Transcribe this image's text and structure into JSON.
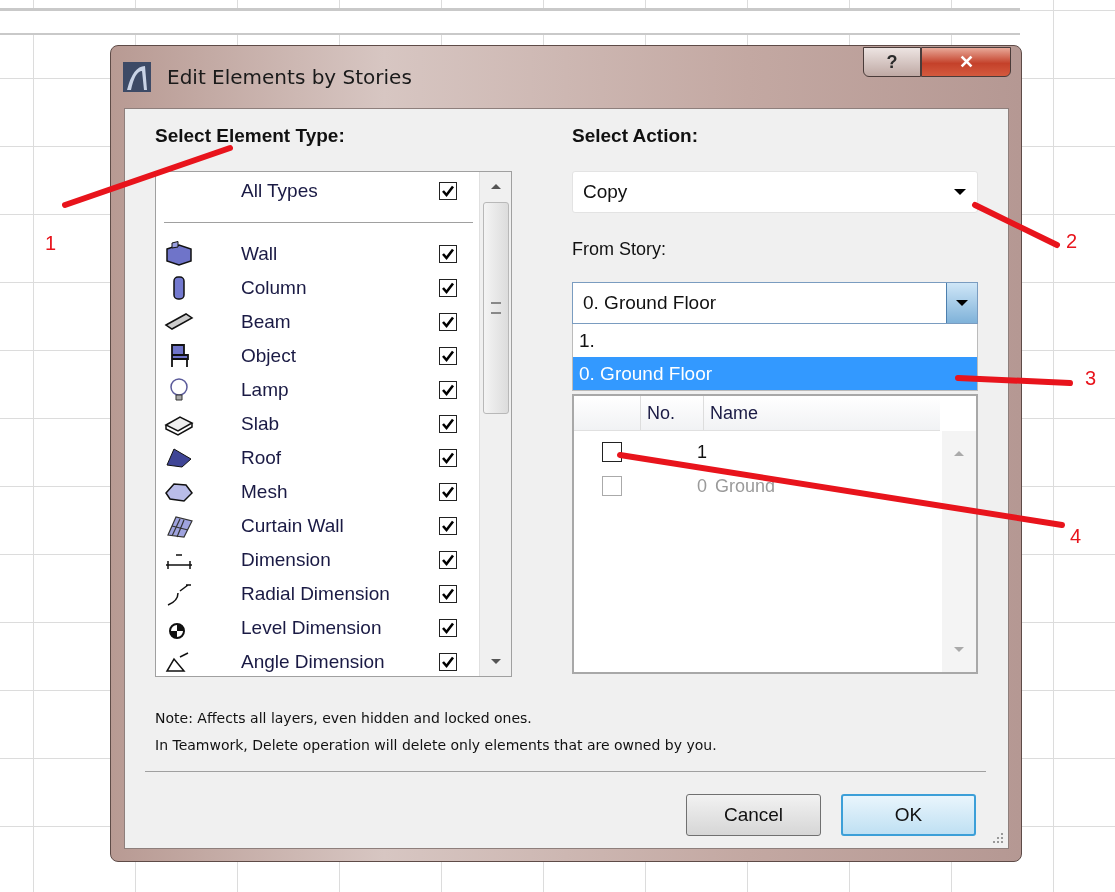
{
  "window": {
    "title": "Edit Elements by Stories"
  },
  "title_buttons": [
    {
      "kind": "help",
      "label": "?"
    },
    {
      "kind": "close",
      "label": "✕"
    }
  ],
  "element_types": {
    "heading": "Select Element Type:",
    "all": {
      "label": "All Types",
      "checked": true
    },
    "items": [
      {
        "label": "Wall",
        "checked": true
      },
      {
        "label": "Column",
        "checked": true
      },
      {
        "label": "Beam",
        "checked": true
      },
      {
        "label": "Object",
        "checked": true
      },
      {
        "label": "Lamp",
        "checked": true
      },
      {
        "label": "Slab",
        "checked": true
      },
      {
        "label": "Roof",
        "checked": true
      },
      {
        "label": "Mesh",
        "checked": true
      },
      {
        "label": "Curtain Wall",
        "checked": true
      },
      {
        "label": "Dimension",
        "checked": true
      },
      {
        "label": "Radial Dimension",
        "checked": true
      },
      {
        "label": "Level Dimension",
        "checked": true
      },
      {
        "label": "Angle Dimension",
        "checked": true
      }
    ]
  },
  "action": {
    "heading": "Select Action:",
    "value": "Copy"
  },
  "from_story": {
    "label": "From Story:",
    "value": "0. Ground Floor",
    "options": [
      {
        "label": "1.",
        "selected": false
      },
      {
        "label": "0. Ground Floor",
        "selected": true
      }
    ]
  },
  "story_table": {
    "columns": [
      "No.",
      "Name"
    ],
    "rows": [
      {
        "number": "1",
        "checked": false,
        "disabled": false
      },
      {
        "number": "0",
        "name": "Ground",
        "checked": false,
        "disabled": true
      }
    ]
  },
  "notes": [
    "Note: Affects all layers, even hidden and locked ones.",
    "In Teamwork, Delete operation will delete only elements that are owned by you."
  ],
  "buttons": [
    {
      "label": "Cancel",
      "default": false
    },
    {
      "label": "OK",
      "default": true
    }
  ],
  "annotations": [
    {
      "label": "1"
    },
    {
      "label": "2"
    },
    {
      "label": "3"
    },
    {
      "label": "4"
    }
  ]
}
